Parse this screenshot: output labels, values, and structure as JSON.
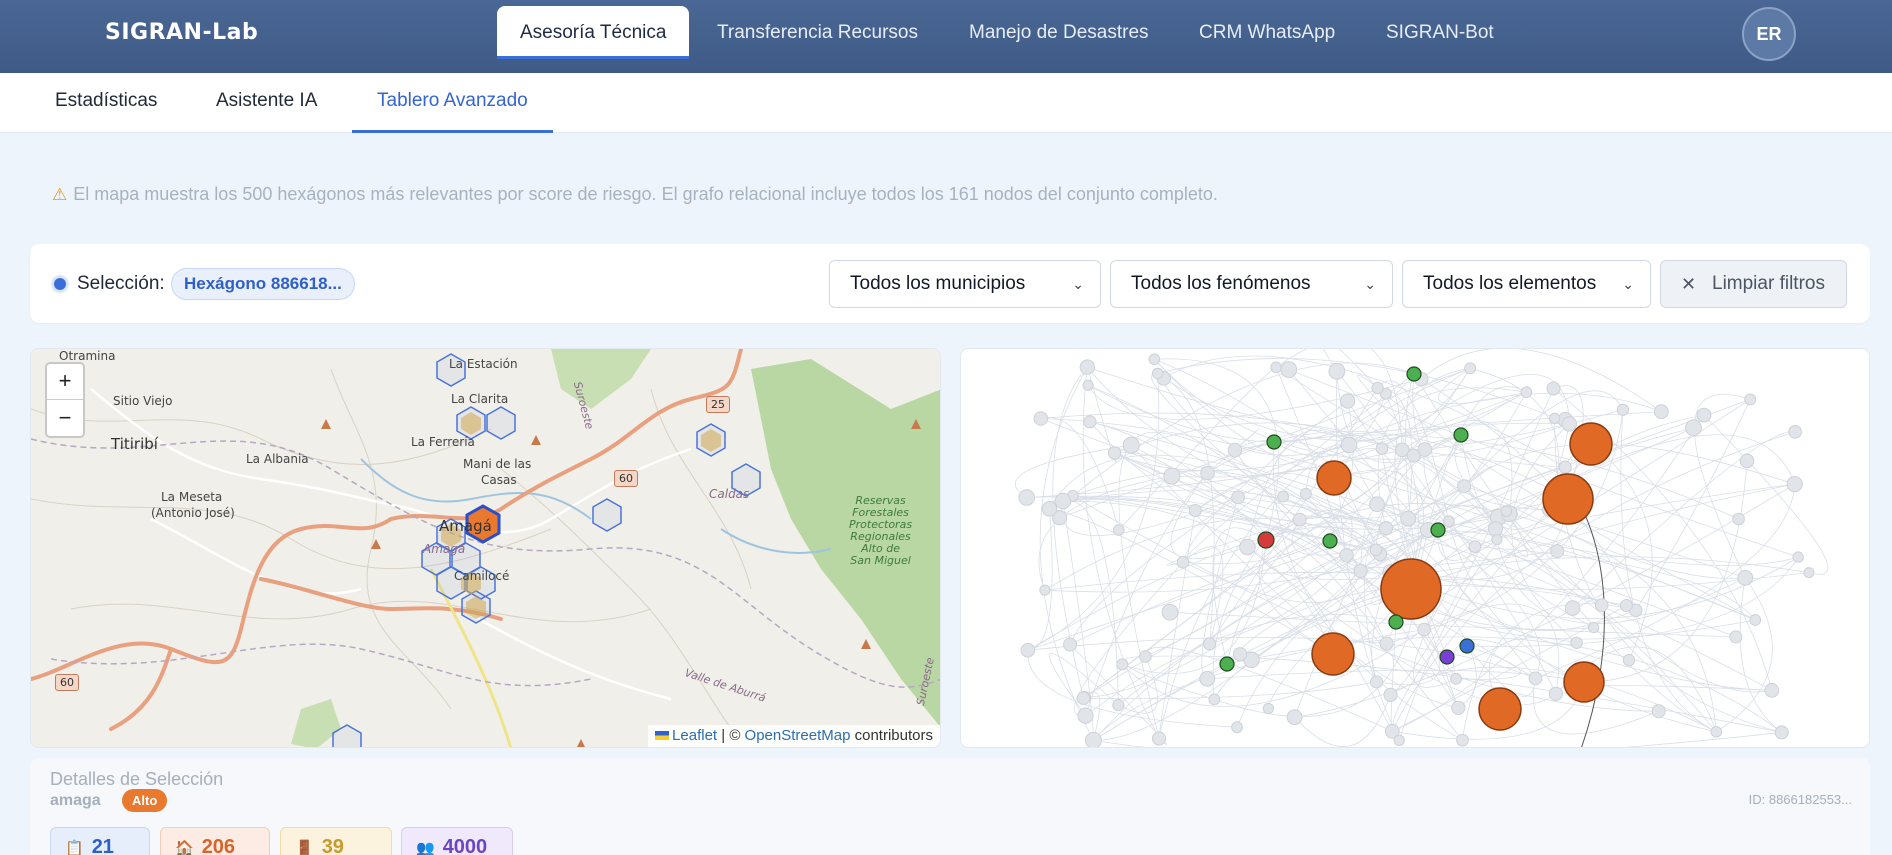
{
  "brand": "SIGRAN-Lab",
  "nav": {
    "tabs": [
      {
        "label": "Asesoría Técnica",
        "active": true
      },
      {
        "label": "Transferencia Recursos"
      },
      {
        "label": "Manejo de Desastres"
      },
      {
        "label": "CRM WhatsApp"
      },
      {
        "label": "SIGRAN-Bot"
      }
    ],
    "avatar": "ER"
  },
  "subtabs": [
    {
      "label": "Estadísticas"
    },
    {
      "label": "Asistente IA"
    },
    {
      "label": "Tablero Avanzado",
      "active": true
    }
  ],
  "notice": {
    "icon": "warning-icon",
    "text": "El mapa muestra los 500 hexágonos más relevantes por score de riesgo. El grafo relacional incluye todos los 161 nodos del conjunto completo."
  },
  "filters": {
    "selection_label": "Selección:",
    "selection_value": "Hexágono 886618...",
    "municipios": "Todos los municipios",
    "fenomenos": "Todos los fenómenos",
    "elementos": "Todos los elementos",
    "clear": "Limpiar filtros"
  },
  "map": {
    "zoom_in": "+",
    "zoom_out": "−",
    "attribution": {
      "leaflet": "Leaflet",
      "sep": " | © ",
      "osm": "OpenStreetMap",
      "contributors": " contributors"
    },
    "places": {
      "otramina": "Otramina",
      "la_estacion": "La Estación",
      "sitio_viejo": "Sitio Viejo",
      "la_clarita": "La Clarita",
      "suroeste_top": "Suroeste",
      "titiribi": "Titiribí",
      "la_albania": "La Albania",
      "la_ferreria": "La Ferrería",
      "mani": "Mani de las",
      "mani2": "Casas",
      "la_meseta": "La Meseta",
      "antonio": "(Antonio José)",
      "amaga_big": "Amagá",
      "amaga_small": "Amagá",
      "camilo": "Camilocé",
      "caldas": "Caldas",
      "reservas": "Reservas\nForestales\nProtectoras\nRegionales\nAlto de\nSan Miguel",
      "valle": "Valle de Aburrá",
      "suroeste_right": "Suroeste"
    },
    "roads": {
      "r25": "25",
      "r60a": "60",
      "r60b": "60"
    }
  },
  "details": {
    "title": "Detalles de Selección",
    "municipio": "amaga",
    "level": "Alto",
    "id": "ID: 8866182553...",
    "stats": [
      {
        "icon": "clipboard-icon",
        "value": "21",
        "color": "#2f5fc8",
        "bg": "#e6eefb",
        "border": "#c9d7f2"
      },
      {
        "icon": "house-icon",
        "value": "206",
        "color": "#d7652a",
        "bg": "#fcece3",
        "border": "#f3cdb8"
      },
      {
        "icon": "door-icon",
        "value": "39",
        "color": "#c89a2a",
        "bg": "#fbf3dd",
        "border": "#efdcaa"
      },
      {
        "icon": "people-icon",
        "value": "4000",
        "color": "#6b46c1",
        "bg": "#efe9fb",
        "border": "#d8ccf3"
      }
    ]
  },
  "colors": {
    "accent": "#3b6fd8",
    "node_orange": "#e06a25",
    "node_green": "#4caf50",
    "node_red": "#d63a3a",
    "node_blue": "#3b6fd8",
    "node_purple": "#7b3fd8"
  }
}
